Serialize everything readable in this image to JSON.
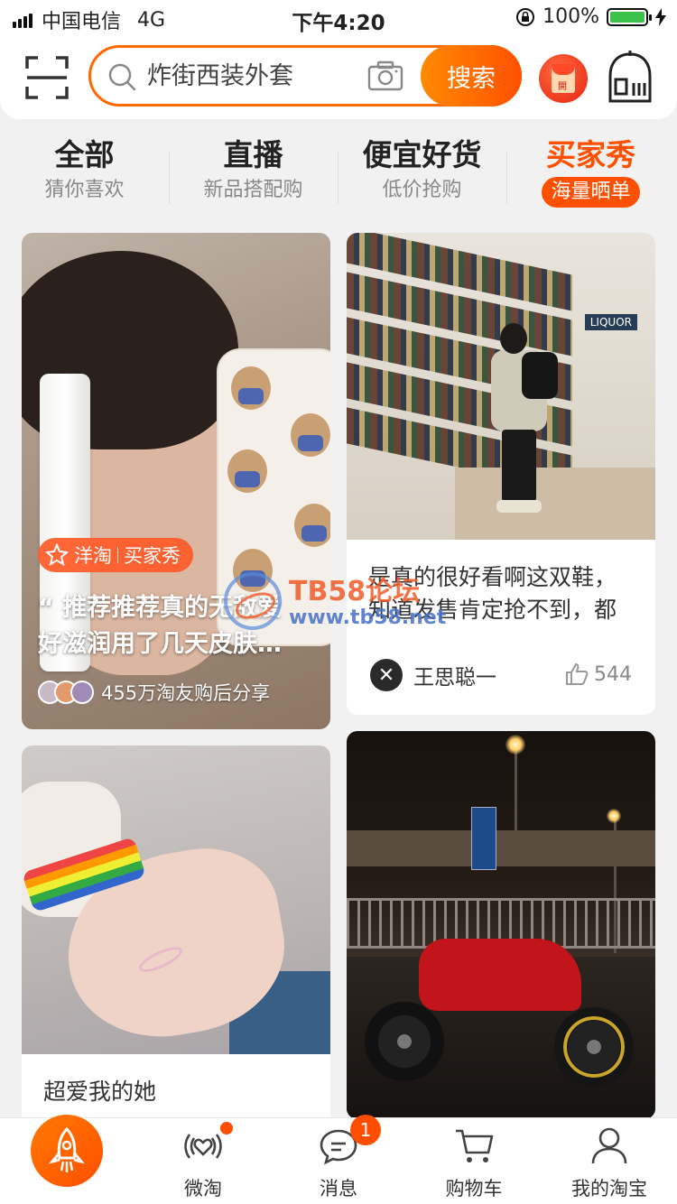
{
  "status_bar": {
    "carrier": "中国电信",
    "network": "4G",
    "time": "下午4:20",
    "battery": "100%"
  },
  "search": {
    "placeholder": "炸街西装外套",
    "button_label": "搜索"
  },
  "redpack_label": "開",
  "tabs": [
    {
      "title": "全部",
      "subtitle": "猜你喜欢",
      "active": false
    },
    {
      "title": "直播",
      "subtitle": "新品搭配购",
      "active": false
    },
    {
      "title": "便宜好货",
      "subtitle": "低价抢购",
      "active": false
    },
    {
      "title": "买家秀",
      "subtitle": "海量晒单",
      "active": true
    }
  ],
  "cards": {
    "card1": {
      "badge_left": "洋淘",
      "badge_right": "买家秀",
      "quote": "“ 推荐推荐真的无敌爱\n好滋润用了几天皮肤…",
      "footer": "455万淘友购后分享"
    },
    "card2": {
      "line1": "是真的很好看啊这双鞋，",
      "line2": "知道发售肯定抢不到，都",
      "author": "王思聪一",
      "likes": "544",
      "store_sign": "LIQUOR"
    },
    "card3": {
      "caption": "超爱我的她"
    }
  },
  "watermark": {
    "title": "TB58论坛",
    "url": "www.tb58.net"
  },
  "tabbar": {
    "items": [
      {
        "label": "",
        "icon": "rocket-icon"
      },
      {
        "label": "微淘",
        "icon": "broadcast-heart-icon"
      },
      {
        "label": "消息",
        "icon": "chat-bubble-icon",
        "badge": "1"
      },
      {
        "label": "购物车",
        "icon": "cart-icon"
      },
      {
        "label": "我的淘宝",
        "icon": "user-icon"
      }
    ]
  },
  "colors": {
    "accent": "#ff5000",
    "accent_light": "#ff8a00",
    "battery_green": "#3bc24a"
  }
}
